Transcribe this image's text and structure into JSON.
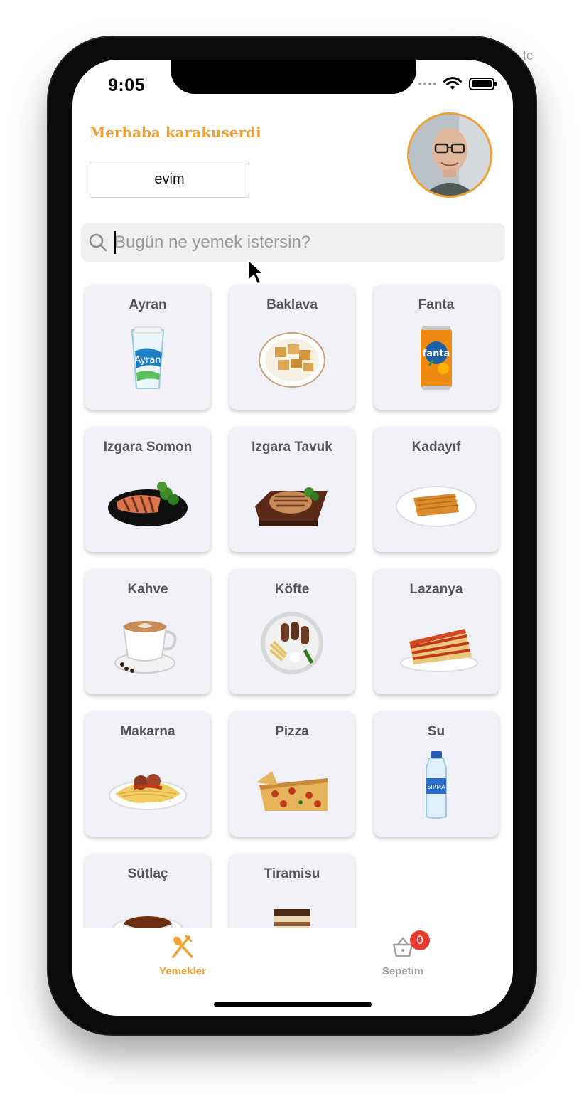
{
  "status_bar": {
    "time": "9:05"
  },
  "header": {
    "greeting": "Merhaba karakuserdi",
    "address_label": "evim"
  },
  "search": {
    "placeholder": "Bugün ne yemek istersin?",
    "value": ""
  },
  "foods": [
    {
      "name": "Ayran",
      "icon": "ayran-cup-icon"
    },
    {
      "name": "Baklava",
      "icon": "baklava-plate-icon"
    },
    {
      "name": "Fanta",
      "icon": "fanta-can-icon"
    },
    {
      "name": "Izgara Somon",
      "icon": "grilled-salmon-icon"
    },
    {
      "name": "Izgara Tavuk",
      "icon": "grilled-chicken-icon"
    },
    {
      "name": "Kadayıf",
      "icon": "kadayif-plate-icon"
    },
    {
      "name": "Kahve",
      "icon": "coffee-cup-icon"
    },
    {
      "name": "Köfte",
      "icon": "kofte-plate-icon"
    },
    {
      "name": "Lazanya",
      "icon": "lasagna-icon"
    },
    {
      "name": "Makarna",
      "icon": "pasta-plate-icon"
    },
    {
      "name": "Pizza",
      "icon": "pizza-icon"
    },
    {
      "name": "Su",
      "icon": "water-bottle-icon"
    },
    {
      "name": "Sütlaç",
      "icon": "sutlac-bowl-icon"
    },
    {
      "name": "Tiramisu",
      "icon": "tiramisu-icon"
    }
  ],
  "tabbar": {
    "items": [
      {
        "label": "Yemekler",
        "icon": "fork-spoon-icon",
        "active": true
      },
      {
        "label": "Sepetim",
        "icon": "basket-icon",
        "active": false
      }
    ],
    "cart_badge": "0"
  },
  "colors": {
    "accent": "#f0a135",
    "card_bg": "#f1f0f6",
    "badge": "#e83b2f"
  },
  "side_text": "tc"
}
